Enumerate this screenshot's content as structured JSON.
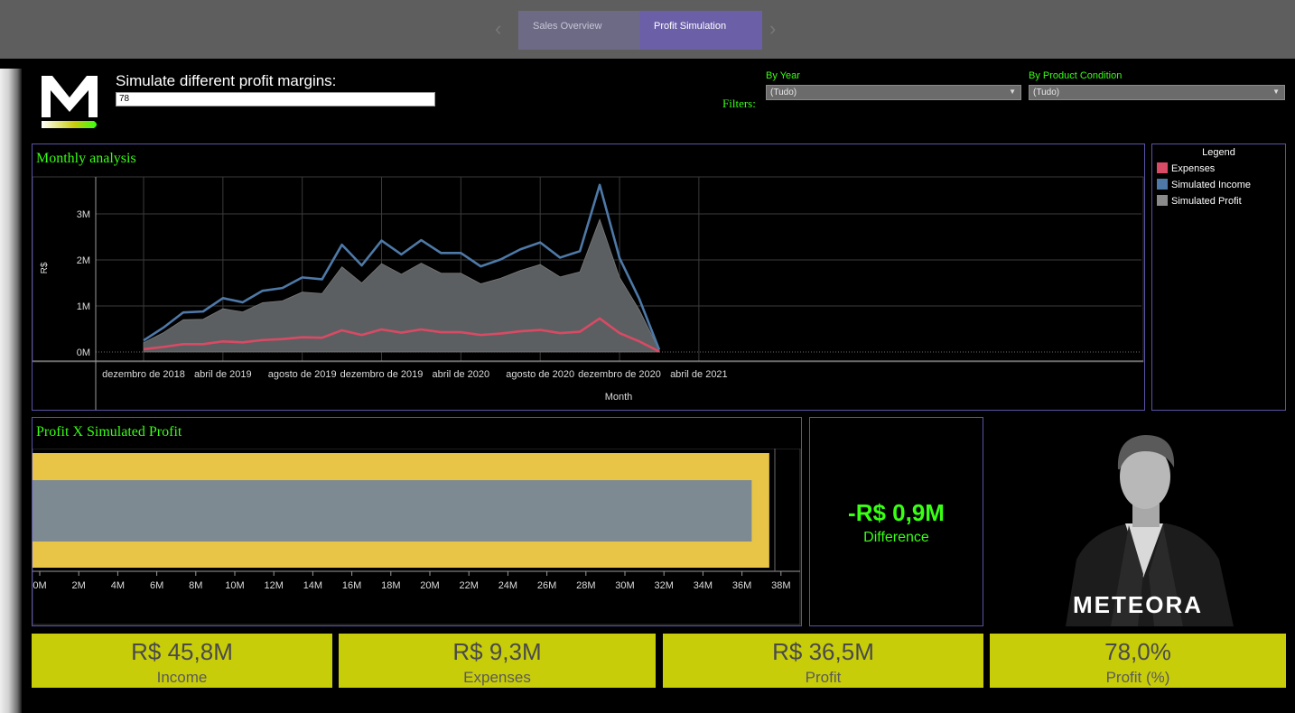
{
  "tabs": [
    {
      "label": "Sales Overview",
      "active": false
    },
    {
      "label": "Profit Simulation",
      "active": true
    }
  ],
  "header": {
    "logo_icon": "meteora-m-logo-icon",
    "simulate_label": "Simulate different profit margins:",
    "simulate_value": "78",
    "filters_label": "Filters:",
    "filters": [
      {
        "title": "By Year",
        "value": "(Tudo)"
      },
      {
        "title": "By Product Condition",
        "value": "(Tudo)"
      }
    ]
  },
  "monthly": {
    "title": "Monthly analysis",
    "ylabel": "R$",
    "xlabel": "Month",
    "y_ticks": [
      "0M",
      "1M",
      "2M",
      "3M"
    ],
    "x_ticks": [
      "dezembro de 2018",
      "abril de 2019",
      "agosto de 2019",
      "dezembro de 2019",
      "abril de 2020",
      "agosto de 2020",
      "dezembro de 2020",
      "abril de 2021"
    ]
  },
  "legend": {
    "title": "Legend",
    "items": [
      {
        "label": "Expenses",
        "color": "#d94a64"
      },
      {
        "label": "Simulated Income",
        "color": "#4e79a7"
      },
      {
        "label": "Simulated Profit",
        "color": "#8a8a8a"
      }
    ]
  },
  "profit_vs_sim": {
    "title": "Profit X Simulated Profit",
    "x_ticks": [
      "0M",
      "2M",
      "4M",
      "6M",
      "8M",
      "10M",
      "12M",
      "14M",
      "16M",
      "18M",
      "20M",
      "22M",
      "24M",
      "26M",
      "28M",
      "30M",
      "32M",
      "34M",
      "36M",
      "38M"
    ]
  },
  "difference": {
    "value": "-R$ 0,9M",
    "label": "Difference"
  },
  "brand": {
    "name": "METEORA"
  },
  "kpis": [
    {
      "value": "R$ 45,8M",
      "label": "Income"
    },
    {
      "value": "R$ 9,3M",
      "label": "Expenses"
    },
    {
      "value": "R$ 36,5M",
      "label": "Profit"
    },
    {
      "value": "78,0%",
      "label": "Profit (%)"
    }
  ],
  "chart_data": [
    {
      "type": "area",
      "title": "Monthly analysis",
      "xlabel": "Month",
      "ylabel": "R$",
      "ylim": [
        0,
        3.5
      ],
      "x": [
        "2018-12",
        "2019-01",
        "2019-02",
        "2019-03",
        "2019-04",
        "2019-05",
        "2019-06",
        "2019-07",
        "2019-08",
        "2019-09",
        "2019-10",
        "2019-11",
        "2019-12",
        "2020-01",
        "2020-02",
        "2020-03",
        "2020-04",
        "2020-05",
        "2020-06",
        "2020-07",
        "2020-08",
        "2020-09",
        "2020-10",
        "2020-11",
        "2020-12",
        "2021-01",
        "2021-02",
        "2021-03"
      ],
      "series": [
        {
          "name": "Simulated Income",
          "color": "#4e79a7",
          "values": [
            0.25,
            0.53,
            0.86,
            0.88,
            1.17,
            1.08,
            1.33,
            1.39,
            1.62,
            1.58,
            2.33,
            1.88,
            2.42,
            2.12,
            2.43,
            2.15,
            2.15,
            1.86,
            2.01,
            2.23,
            2.38,
            2.05,
            2.19,
            3.63,
            2.04,
            1.15,
            0.05
          ]
        },
        {
          "name": "Simulated Profit",
          "color": "#8a8a8a",
          "values": [
            0.2,
            0.42,
            0.7,
            0.71,
            0.94,
            0.87,
            1.07,
            1.11,
            1.3,
            1.27,
            1.85,
            1.5,
            1.92,
            1.69,
            1.93,
            1.71,
            1.71,
            1.48,
            1.6,
            1.77,
            1.9,
            1.63,
            1.74,
            2.88,
            1.62,
            0.91,
            0.04
          ]
        },
        {
          "name": "Expenses",
          "color": "#d94a64",
          "values": [
            0.06,
            0.11,
            0.17,
            0.17,
            0.23,
            0.21,
            0.26,
            0.28,
            0.32,
            0.31,
            0.47,
            0.37,
            0.49,
            0.42,
            0.49,
            0.43,
            0.43,
            0.37,
            0.4,
            0.45,
            0.48,
            0.41,
            0.44,
            0.73,
            0.41,
            0.23,
            0.01
          ]
        }
      ]
    },
    {
      "type": "bar",
      "title": "Profit X Simulated Profit",
      "orientation": "horizontal",
      "xlim": [
        0,
        38
      ],
      "series": [
        {
          "name": "Profit",
          "color": "#e8c547",
          "values": [
            37.4
          ]
        },
        {
          "name": "Simulated Profit",
          "color": "#7e8a92",
          "values": [
            36.5
          ]
        }
      ]
    }
  ]
}
